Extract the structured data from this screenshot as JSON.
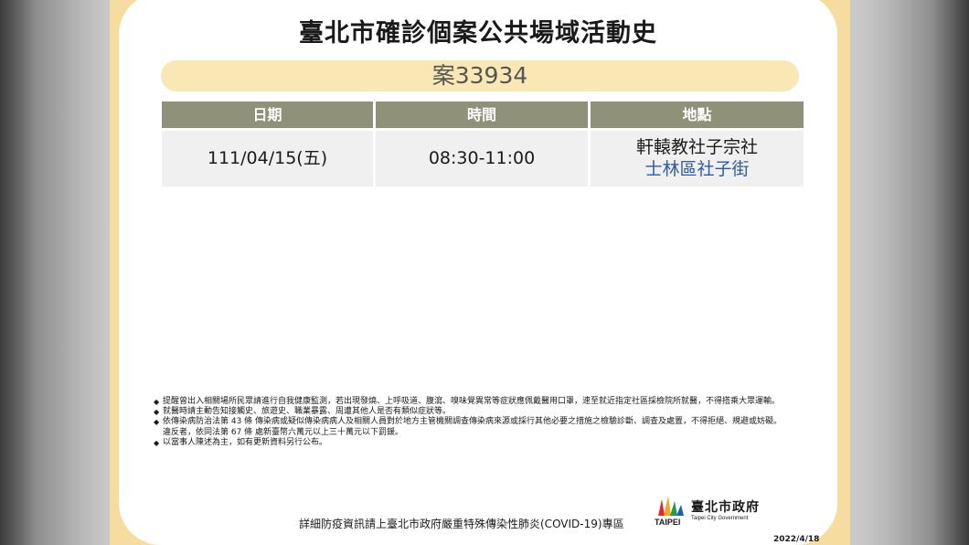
{
  "title": "臺北市確診個案公共場域活動史",
  "case_label": "案33934",
  "table": {
    "headers": [
      "日期",
      "時間",
      "地點"
    ],
    "row": {
      "date": "111/04/15(五)",
      "time": "08:30-11:00",
      "place_name": "軒轅教社子宗社",
      "place_address": "士林區社子街"
    }
  },
  "notes": [
    "提醒曾出入相關場所民眾請進行自我健康監測，若出現發燒、上呼吸道、腹瀉、嗅味覺異常等症狀應佩戴醫用口罩，速至就近指定社區採檢院所就醫，不得搭乘大眾運輸。",
    "就醫時請主動告知接觸史、旅遊史、職業暴露、周遭其他人是否有類似症狀等。",
    "依傳染病防治法第 43 條 傳染病或疑似傳染病病人及相關人員對於地方主管機關調查傳染病來源或採行其他必要之措施之檢驗診斷、調查及處置，不得拒絕、規避或妨礙。",
    "違反者，依同法第 67 條 處新臺幣六萬元以上三十萬元以下罰鍰。",
    "以當事人陳述為主，如有更新資料另行公布。"
  ],
  "footer": "詳細防疫資訊請上臺北市政府嚴重特殊傳染性肺炎(COVID-19)專區",
  "logo": {
    "en": "TAIPEI",
    "cn": "臺北市政府",
    "sub": "Taipei City Government",
    "colors": [
      "#e6262b",
      "#f5a623",
      "#1a9e4a",
      "#1d5fb4"
    ]
  },
  "date": "2022/4/18"
}
